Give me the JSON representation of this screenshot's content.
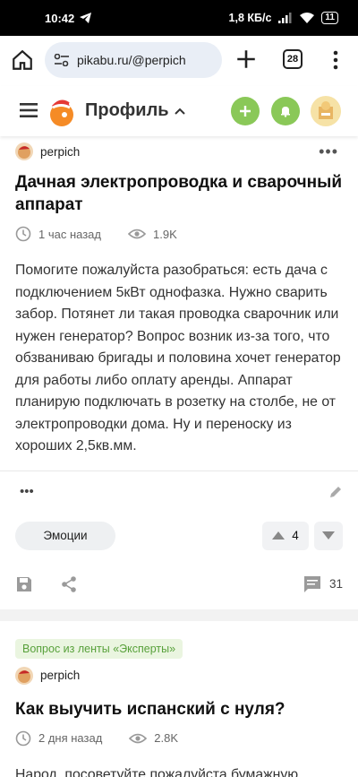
{
  "status": {
    "time": "10:42",
    "net_speed": "1,8 КБ/с",
    "battery": "11"
  },
  "browser": {
    "url": "pikabu.ru/@perpich",
    "tab_count": "28"
  },
  "header": {
    "title": "Профиль"
  },
  "posts": [
    {
      "author": "perpich",
      "title": "Дачная электропроводка и сварочный аппарат",
      "time": "1 час назад",
      "views": "1.9K",
      "body": "Помогите пожалуйста разобраться: есть дача с подключением 5кВт однофазка. Нужно сварить забор. Потянет ли такая проводка сварочник или нужен генератор? Вопрос возник из-за того, что обзваниваю бригады и половина хочет генератор для работы либо оплату аренды. Аппарат планирую подключать в розетку на столбе, не от электропроводки дома. Ну и переноску из хороших 2,5кв.мм.",
      "emotions_label": "Эмоции",
      "rating": "4",
      "comments": "31"
    },
    {
      "tag": "Вопрос из ленты «Эксперты»",
      "author": "perpich",
      "title": "Как выучить испанский с нуля?",
      "time": "2 дня назад",
      "views": "2.8K",
      "body": "Народ, посоветуйте пожалуйста бумажную литературу по испанскому языку. Вот,"
    }
  ]
}
